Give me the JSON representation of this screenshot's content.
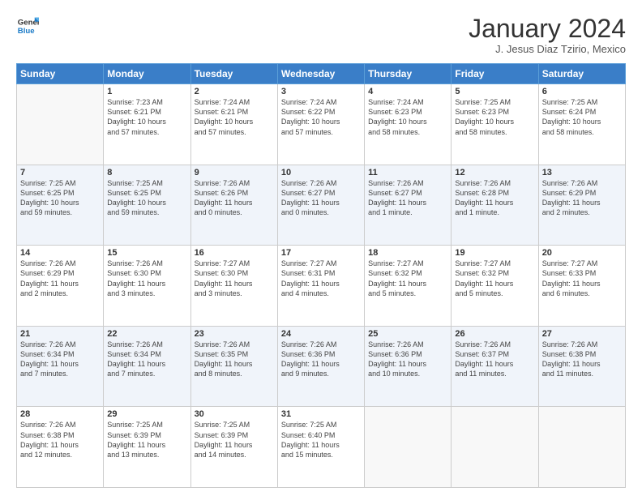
{
  "logo": {
    "line1": "General",
    "line2": "Blue"
  },
  "title": "January 2024",
  "location": "J. Jesus Diaz Tzirio, Mexico",
  "weekdays": [
    "Sunday",
    "Monday",
    "Tuesday",
    "Wednesday",
    "Thursday",
    "Friday",
    "Saturday"
  ],
  "weeks": [
    [
      {
        "day": "",
        "info": ""
      },
      {
        "day": "1",
        "info": "Sunrise: 7:23 AM\nSunset: 6:21 PM\nDaylight: 10 hours\nand 57 minutes."
      },
      {
        "day": "2",
        "info": "Sunrise: 7:24 AM\nSunset: 6:21 PM\nDaylight: 10 hours\nand 57 minutes."
      },
      {
        "day": "3",
        "info": "Sunrise: 7:24 AM\nSunset: 6:22 PM\nDaylight: 10 hours\nand 57 minutes."
      },
      {
        "day": "4",
        "info": "Sunrise: 7:24 AM\nSunset: 6:23 PM\nDaylight: 10 hours\nand 58 minutes."
      },
      {
        "day": "5",
        "info": "Sunrise: 7:25 AM\nSunset: 6:23 PM\nDaylight: 10 hours\nand 58 minutes."
      },
      {
        "day": "6",
        "info": "Sunrise: 7:25 AM\nSunset: 6:24 PM\nDaylight: 10 hours\nand 58 minutes."
      }
    ],
    [
      {
        "day": "7",
        "info": "Sunrise: 7:25 AM\nSunset: 6:25 PM\nDaylight: 10 hours\nand 59 minutes."
      },
      {
        "day": "8",
        "info": "Sunrise: 7:25 AM\nSunset: 6:25 PM\nDaylight: 10 hours\nand 59 minutes."
      },
      {
        "day": "9",
        "info": "Sunrise: 7:26 AM\nSunset: 6:26 PM\nDaylight: 11 hours\nand 0 minutes."
      },
      {
        "day": "10",
        "info": "Sunrise: 7:26 AM\nSunset: 6:27 PM\nDaylight: 11 hours\nand 0 minutes."
      },
      {
        "day": "11",
        "info": "Sunrise: 7:26 AM\nSunset: 6:27 PM\nDaylight: 11 hours\nand 1 minute."
      },
      {
        "day": "12",
        "info": "Sunrise: 7:26 AM\nSunset: 6:28 PM\nDaylight: 11 hours\nand 1 minute."
      },
      {
        "day": "13",
        "info": "Sunrise: 7:26 AM\nSunset: 6:29 PM\nDaylight: 11 hours\nand 2 minutes."
      }
    ],
    [
      {
        "day": "14",
        "info": "Sunrise: 7:26 AM\nSunset: 6:29 PM\nDaylight: 11 hours\nand 2 minutes."
      },
      {
        "day": "15",
        "info": "Sunrise: 7:26 AM\nSunset: 6:30 PM\nDaylight: 11 hours\nand 3 minutes."
      },
      {
        "day": "16",
        "info": "Sunrise: 7:27 AM\nSunset: 6:30 PM\nDaylight: 11 hours\nand 3 minutes."
      },
      {
        "day": "17",
        "info": "Sunrise: 7:27 AM\nSunset: 6:31 PM\nDaylight: 11 hours\nand 4 minutes."
      },
      {
        "day": "18",
        "info": "Sunrise: 7:27 AM\nSunset: 6:32 PM\nDaylight: 11 hours\nand 5 minutes."
      },
      {
        "day": "19",
        "info": "Sunrise: 7:27 AM\nSunset: 6:32 PM\nDaylight: 11 hours\nand 5 minutes."
      },
      {
        "day": "20",
        "info": "Sunrise: 7:27 AM\nSunset: 6:33 PM\nDaylight: 11 hours\nand 6 minutes."
      }
    ],
    [
      {
        "day": "21",
        "info": "Sunrise: 7:26 AM\nSunset: 6:34 PM\nDaylight: 11 hours\nand 7 minutes."
      },
      {
        "day": "22",
        "info": "Sunrise: 7:26 AM\nSunset: 6:34 PM\nDaylight: 11 hours\nand 7 minutes."
      },
      {
        "day": "23",
        "info": "Sunrise: 7:26 AM\nSunset: 6:35 PM\nDaylight: 11 hours\nand 8 minutes."
      },
      {
        "day": "24",
        "info": "Sunrise: 7:26 AM\nSunset: 6:36 PM\nDaylight: 11 hours\nand 9 minutes."
      },
      {
        "day": "25",
        "info": "Sunrise: 7:26 AM\nSunset: 6:36 PM\nDaylight: 11 hours\nand 10 minutes."
      },
      {
        "day": "26",
        "info": "Sunrise: 7:26 AM\nSunset: 6:37 PM\nDaylight: 11 hours\nand 11 minutes."
      },
      {
        "day": "27",
        "info": "Sunrise: 7:26 AM\nSunset: 6:38 PM\nDaylight: 11 hours\nand 11 minutes."
      }
    ],
    [
      {
        "day": "28",
        "info": "Sunrise: 7:26 AM\nSunset: 6:38 PM\nDaylight: 11 hours\nand 12 minutes."
      },
      {
        "day": "29",
        "info": "Sunrise: 7:25 AM\nSunset: 6:39 PM\nDaylight: 11 hours\nand 13 minutes."
      },
      {
        "day": "30",
        "info": "Sunrise: 7:25 AM\nSunset: 6:39 PM\nDaylight: 11 hours\nand 14 minutes."
      },
      {
        "day": "31",
        "info": "Sunrise: 7:25 AM\nSunset: 6:40 PM\nDaylight: 11 hours\nand 15 minutes."
      },
      {
        "day": "",
        "info": ""
      },
      {
        "day": "",
        "info": ""
      },
      {
        "day": "",
        "info": ""
      }
    ]
  ]
}
